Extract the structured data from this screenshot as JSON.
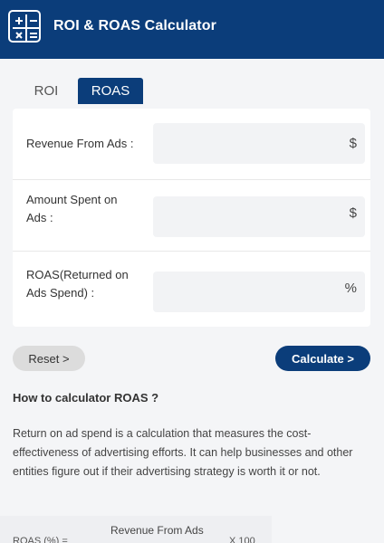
{
  "header": {
    "title": "ROI & ROAS Calculator",
    "icon": "calculator-icon"
  },
  "tabs": [
    {
      "label": "ROI",
      "active": false
    },
    {
      "label": "ROAS",
      "active": true
    }
  ],
  "form": {
    "revenue": {
      "label": "Revenue From Ads :",
      "unit": "$",
      "value": ""
    },
    "spent": {
      "label_line1": "Amount Spent on",
      "label_line2": "Ads :",
      "unit": "$",
      "value": ""
    },
    "roas": {
      "label_line1": "ROAS(Returned on",
      "label_line2": "Ads Spend) :",
      "unit": "%",
      "value": ""
    }
  },
  "buttons": {
    "reset": "Reset >",
    "calculate": "Calculate >"
  },
  "info": {
    "title": "How to calculator ROAS ?",
    "description": "Return on ad spend is a calculation that measures the cost-effectiveness of advertising efforts. It can help businesses and other entities figure out if their advertising strategy is worth it or not."
  },
  "formula": {
    "left": "ROAS (%) =",
    "numerator": "Revenue From Ads",
    "right": "X 100"
  },
  "colors": {
    "primary": "#0b3d7a",
    "background": "#f4f5f7",
    "input": "#f2f3f5"
  }
}
